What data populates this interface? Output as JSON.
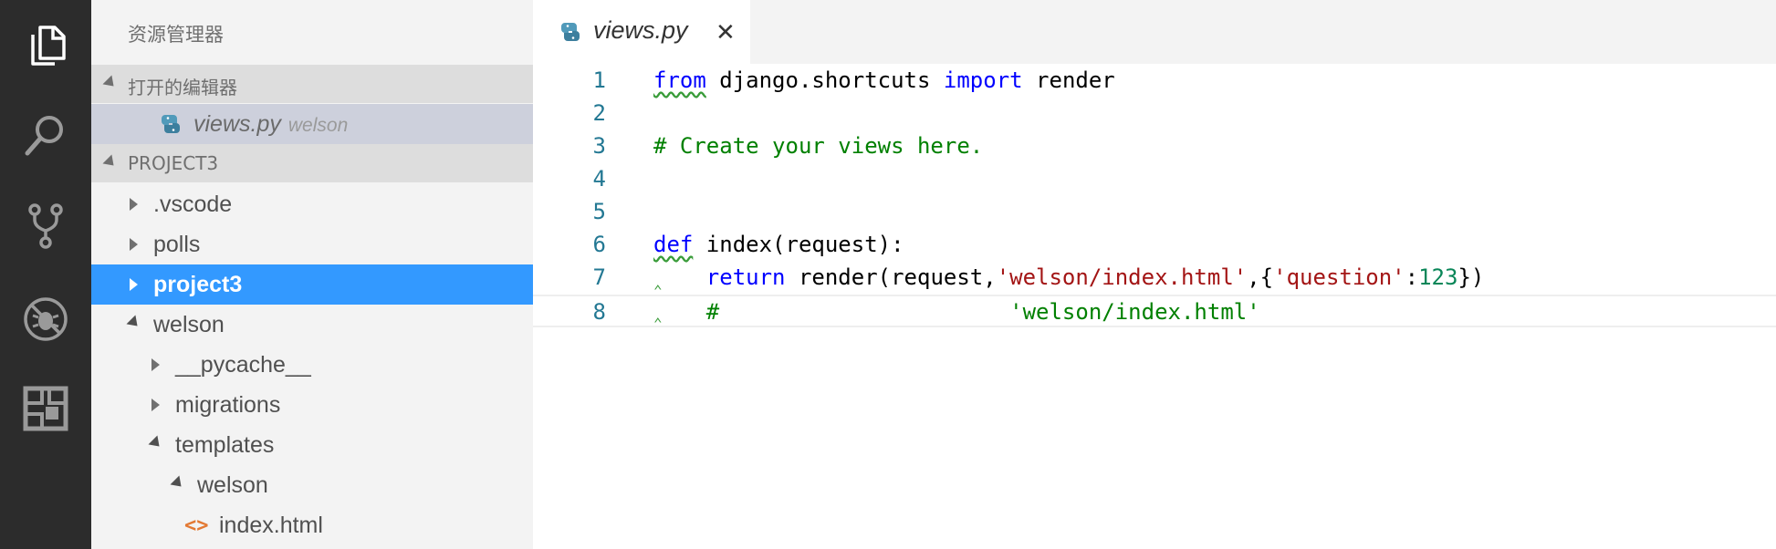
{
  "activity_bar": {
    "icons": [
      "files-icon",
      "search-icon",
      "source-control-icon",
      "debug-icon",
      "extensions-icon"
    ]
  },
  "sidebar": {
    "title": "资源管理器",
    "open_editors": {
      "header": "打开的编辑器",
      "items": [
        {
          "label": "views.py",
          "description": "welson"
        }
      ]
    },
    "project": {
      "header": "PROJECT3",
      "tree": [
        {
          "label": ".vscode"
        },
        {
          "label": "polls"
        },
        {
          "label": "project3"
        },
        {
          "label": "welson"
        },
        {
          "label": "__pycache__"
        },
        {
          "label": "migrations"
        },
        {
          "label": "templates"
        },
        {
          "label": "welson"
        },
        {
          "label": "index.html"
        }
      ]
    }
  },
  "editor": {
    "tab": {
      "label": "views.py",
      "close": "✕"
    },
    "line_numbers": [
      "1",
      "2",
      "3",
      "4",
      "5",
      "6",
      "7",
      "8"
    ],
    "code": {
      "l1_from": "from",
      "l1_mod": " django.shortcuts ",
      "l1_import": "import",
      "l1_name": " render",
      "l3_comment": "# Create your views here.",
      "l6_def": "def",
      "l6_rest": " index(request):",
      "l7_indent": "    ",
      "l7_return": "return",
      "l7_call": " render(request,",
      "l7_str1": "'welson/index.html'",
      "l7_mid": ",{",
      "l7_str2": "'question'",
      "l7_colon": ":",
      "l7_num": "123",
      "l7_end": "})",
      "l8_indent": "    ",
      "l8_comment": "#                      'welson/index.html'"
    }
  },
  "colors": {
    "activity_bar": "#2c2c2c",
    "sidebar": "#f3f3f3",
    "selected": "#3399ff",
    "keyword": "#0000ff",
    "string": "#a31515",
    "number": "#098658",
    "comment": "#008000",
    "line_number": "#237893"
  }
}
